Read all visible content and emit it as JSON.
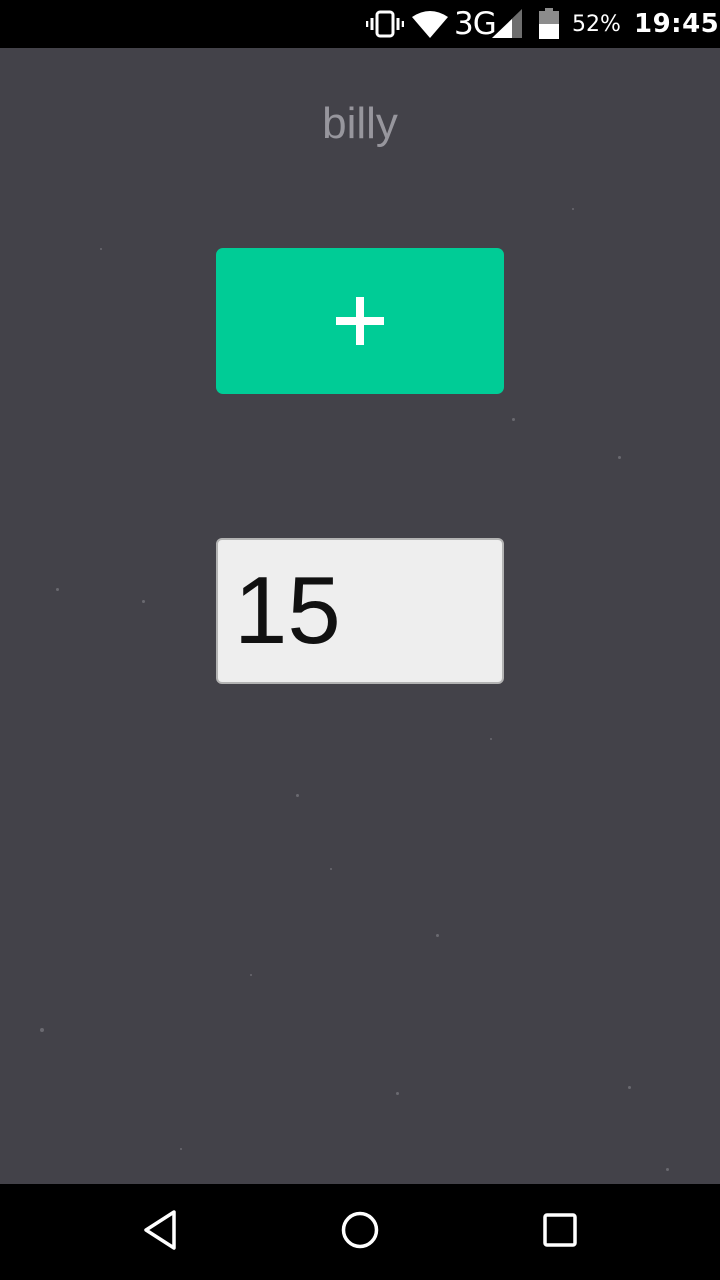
{
  "status_bar": {
    "network": "3G",
    "battery": "52%",
    "time": "19:45",
    "icons": [
      "vibrate-icon",
      "wifi-icon",
      "signal-icon",
      "battery-icon"
    ]
  },
  "main": {
    "user_name": "billy",
    "add_button": {
      "label": "+",
      "color": "#00cc96"
    },
    "count_field": {
      "value": "15"
    }
  },
  "nav_bar": {
    "icons": [
      "back-icon",
      "home-icon",
      "recents-icon"
    ]
  },
  "colors": {
    "background": "#434249",
    "accent": "#00cc96",
    "name_text": "#97969d",
    "bars": "#000000"
  }
}
